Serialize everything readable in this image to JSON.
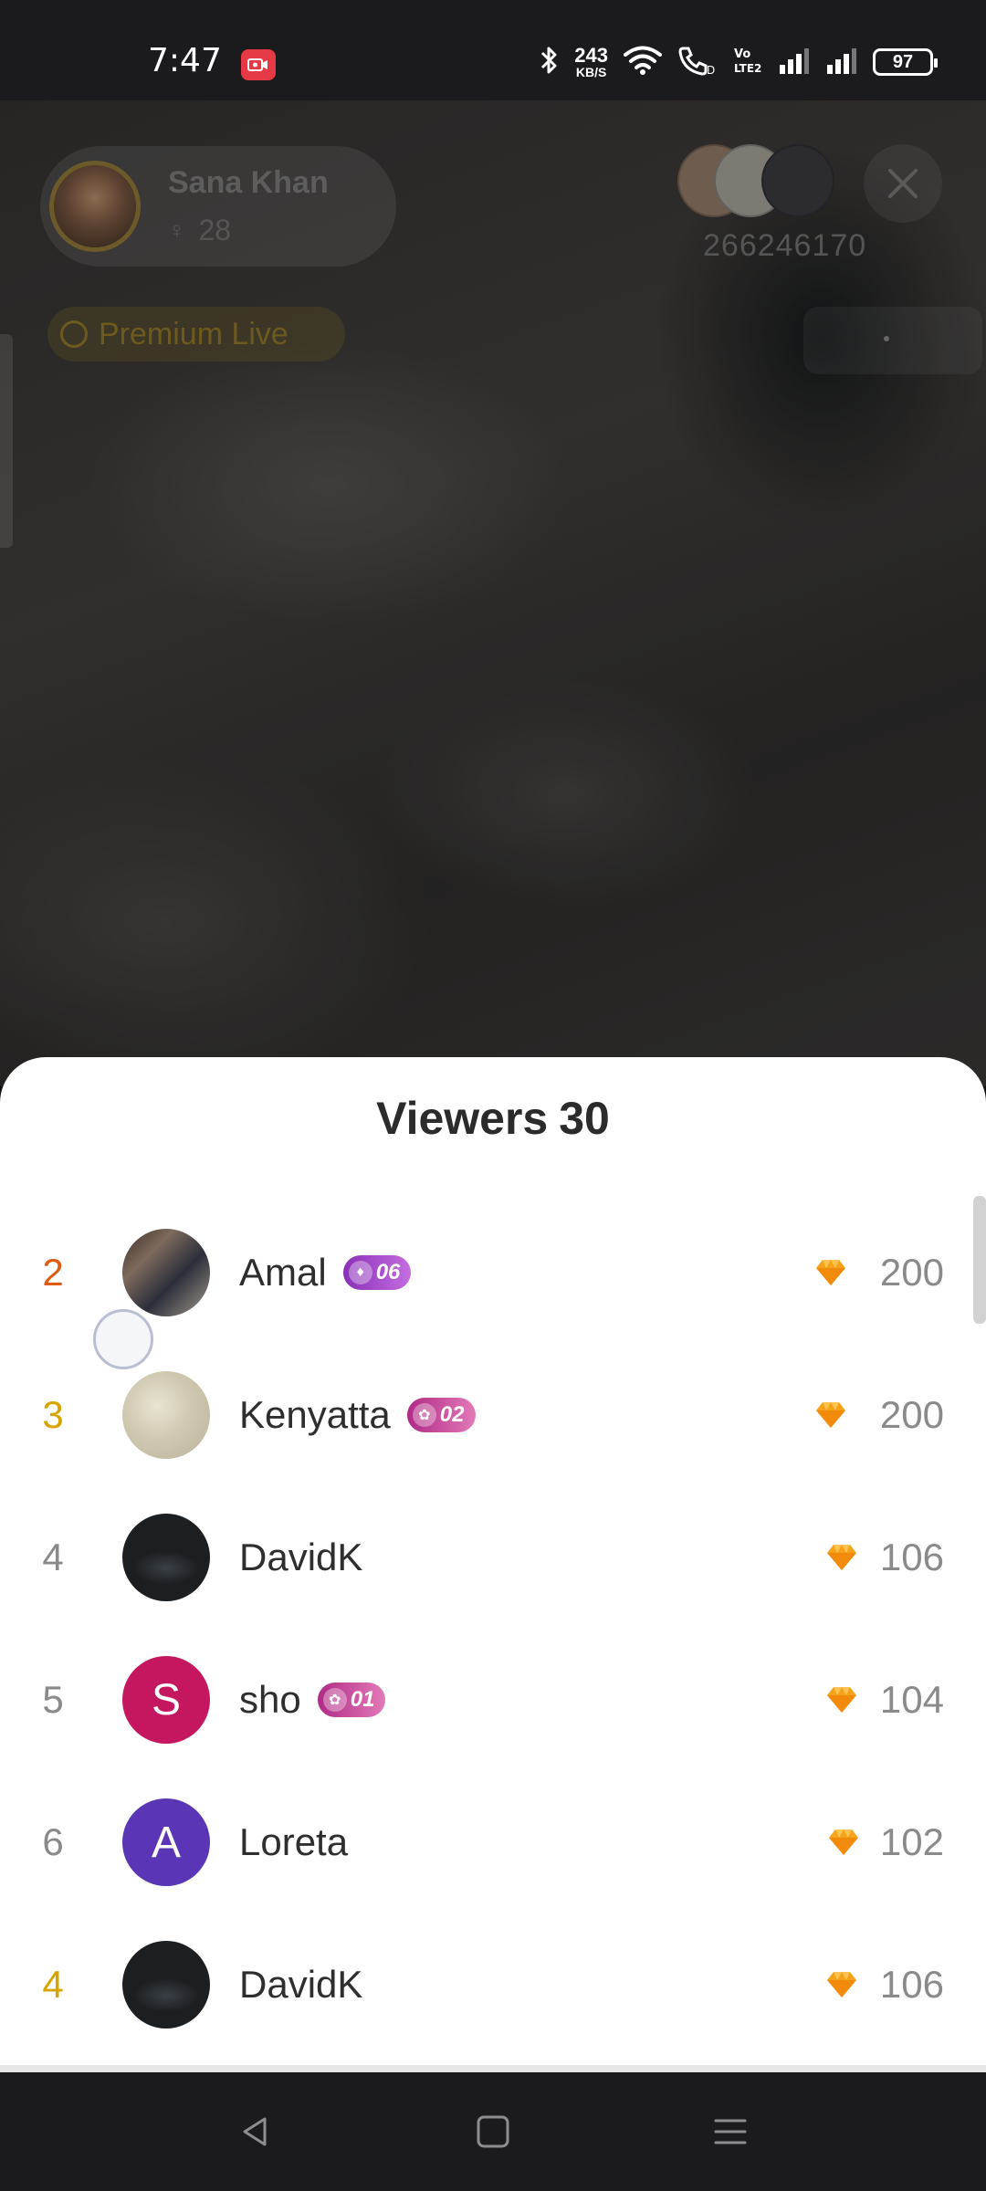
{
  "status_bar": {
    "time": "7:47",
    "net_speed_value": "243",
    "net_speed_unit": "KB/S",
    "volte_label": "Vo LTE2",
    "battery": "97",
    "icons": [
      "screen-record-icon",
      "bluetooth-icon",
      "wifi-icon",
      "wifi-calling-icon",
      "volte-icon",
      "signal-icon",
      "signal-icon",
      "battery-icon"
    ]
  },
  "live": {
    "host_name": "Sana Khan",
    "host_viewer_count": "28",
    "live_id": "266246170",
    "premium_label": "Premium Live"
  },
  "viewers_sheet": {
    "title": "Viewers",
    "count": "30",
    "rows": [
      {
        "rank": "2",
        "name": "Amal",
        "level": "06",
        "amount": "200",
        "avatar_letter": ""
      },
      {
        "rank": "3",
        "name": "Kenyatta",
        "level": "02",
        "amount": "200",
        "avatar_letter": ""
      },
      {
        "rank": "4",
        "name": "DavidK",
        "level": "",
        "amount": "106",
        "avatar_letter": ""
      },
      {
        "rank": "5",
        "name": "sho",
        "level": "01",
        "amount": "104",
        "avatar_letter": "S"
      },
      {
        "rank": "6",
        "name": "Loreta",
        "level": "",
        "amount": "102",
        "avatar_letter": "A"
      },
      {
        "rank": "4",
        "name": "DavidK",
        "level": "",
        "amount": "106",
        "avatar_letter": ""
      }
    ]
  },
  "colors": {
    "rank_2": "#e25a12",
    "rank_gold": "#d8a400",
    "rank_default": "#8a8a8a",
    "avatar_s": "#c4175f",
    "avatar_a": "#5a36b6",
    "gem": "#f7a21b"
  }
}
